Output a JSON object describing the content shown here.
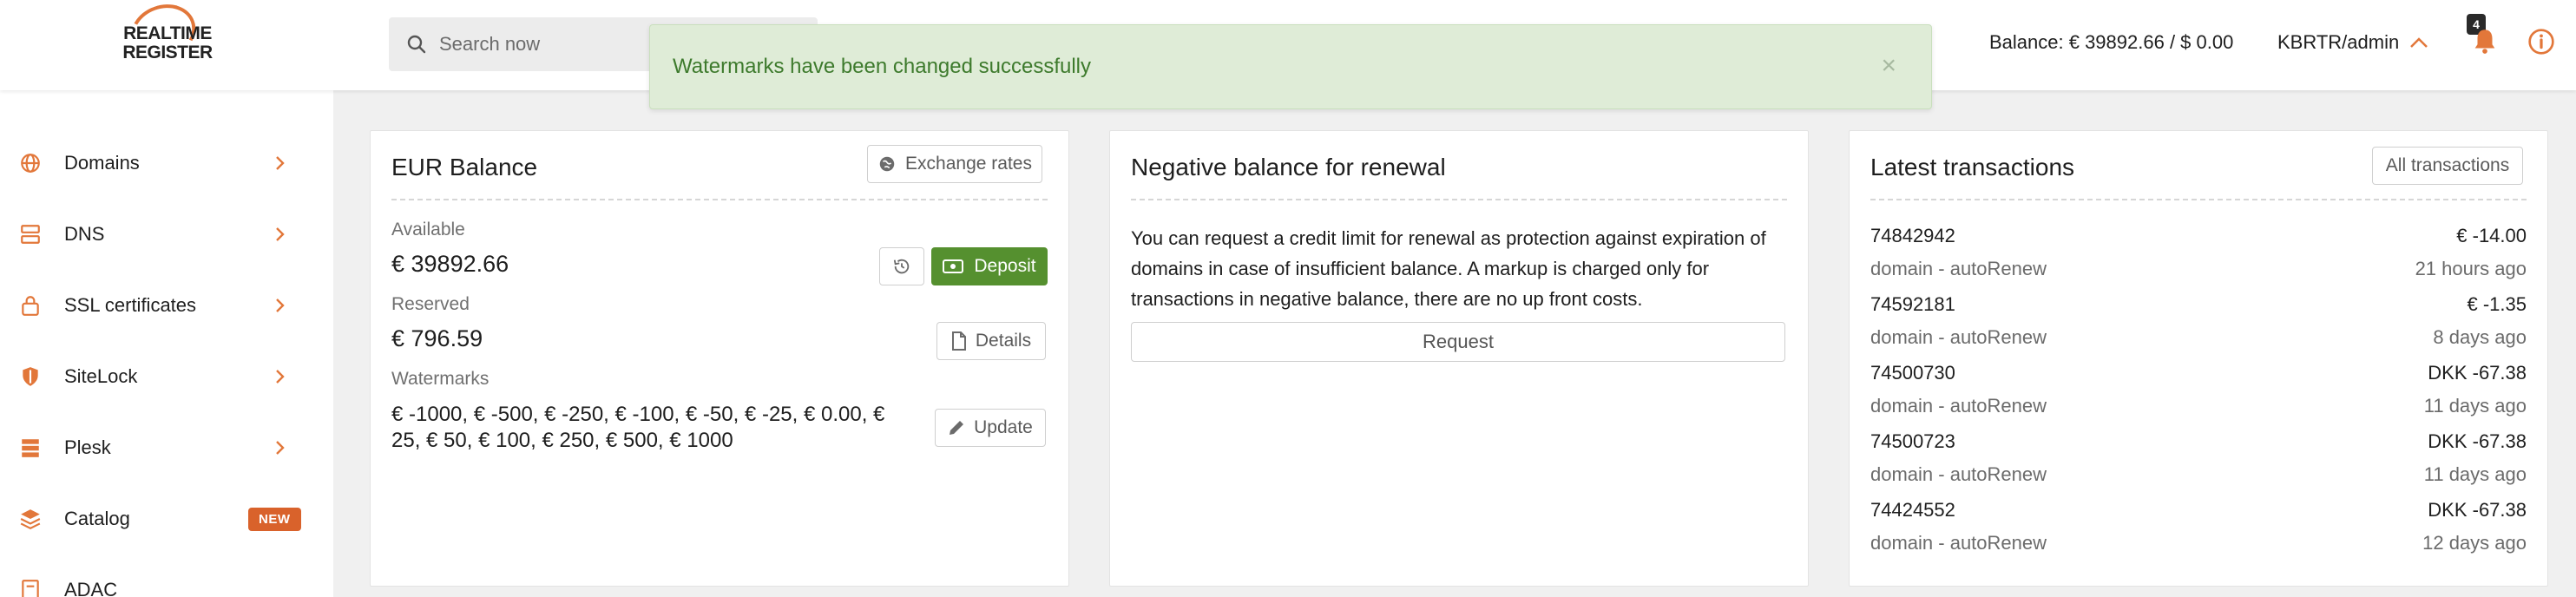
{
  "header": {
    "logo_text_line1": "REALTIME",
    "logo_text_line2": "REGISTER",
    "search_placeholder": "Search now",
    "balance": "Balance: € 39892.66 / $ 0.00",
    "account": "KBRTR/admin",
    "notification_count": "4",
    "accent_color": "#e2773a"
  },
  "toast": {
    "message": "Watermarks have been changed successfully",
    "close": "×",
    "type": "success"
  },
  "sidebar": {
    "items": [
      {
        "label": "Domains",
        "icon": "globe-icon"
      },
      {
        "label": "DNS",
        "icon": "server-icon"
      },
      {
        "label": "SSL certificates",
        "icon": "lock-icon"
      },
      {
        "label": "SiteLock",
        "icon": "shield-icon"
      },
      {
        "label": "Plesk",
        "icon": "plesk-icon"
      },
      {
        "label": "Catalog",
        "icon": "layers-icon",
        "badge": "NEW"
      },
      {
        "label": "ADAC",
        "icon": "document-icon"
      }
    ]
  },
  "eur_balance": {
    "title": "EUR Balance",
    "exchange_rates_button": "Exchange rates",
    "available_label": "Available",
    "available_value": "€ 39892.66",
    "deposit_button": "Deposit",
    "reserved_label": "Reserved",
    "reserved_value": "€ 796.59",
    "details_button": "Details",
    "watermarks_label": "Watermarks",
    "watermarks_value": "€ -1000, € -500, € -250, € -100, € -50, € -25, € 0.00, € 25, € 50, € 100, € 250, € 500, € 1000",
    "update_button": "Update"
  },
  "negative_balance": {
    "title": "Negative balance for renewal",
    "description": "You can request a credit limit for renewal as protection against expiration of domains in case of insufficient balance. A markup is charged only for transactions in negative balance, there are no up front costs.",
    "request_button": "Request"
  },
  "transactions": {
    "title": "Latest transactions",
    "all_button": "All transactions",
    "items": [
      {
        "id": "74842942",
        "desc": "domain - autoRenew",
        "amount": "€ -14.00",
        "time": "21 hours ago"
      },
      {
        "id": "74592181",
        "desc": "domain - autoRenew",
        "amount": "€ -1.35",
        "time": "8 days ago"
      },
      {
        "id": "74500730",
        "desc": "domain - autoRenew",
        "amount": "DKK -67.38",
        "time": "11 days ago"
      },
      {
        "id": "74500723",
        "desc": "domain - autoRenew",
        "amount": "DKK -67.38",
        "time": "11 days ago"
      },
      {
        "id": "74424552",
        "desc": "domain - autoRenew",
        "amount": "DKK -67.38",
        "time": "12 days ago"
      }
    ]
  }
}
